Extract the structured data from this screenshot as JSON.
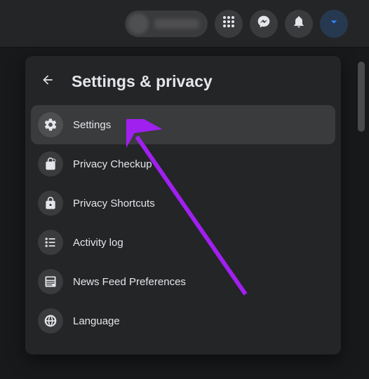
{
  "header": {
    "title": "Settings & privacy"
  },
  "menu": {
    "items": [
      {
        "label": "Settings",
        "icon": "gear-icon",
        "selected": true
      },
      {
        "label": "Privacy Checkup",
        "icon": "lock-heart-icon",
        "selected": false
      },
      {
        "label": "Privacy Shortcuts",
        "icon": "lock-icon",
        "selected": false
      },
      {
        "label": "Activity log",
        "icon": "list-icon",
        "selected": false
      },
      {
        "label": "News Feed Preferences",
        "icon": "feed-icon",
        "selected": false
      },
      {
        "label": "Language",
        "icon": "globe-icon",
        "selected": false
      }
    ]
  },
  "topbar": {
    "icons": [
      "apps-icon",
      "messenger-icon",
      "bell-icon",
      "caret-down-icon"
    ]
  }
}
